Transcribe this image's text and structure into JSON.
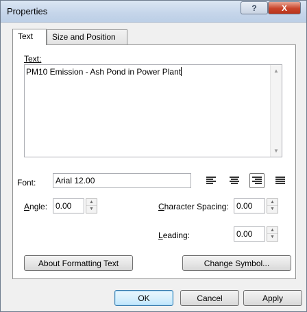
{
  "window": {
    "title": "Properties",
    "help_glyph": "?",
    "close_glyph": "X"
  },
  "tabs": [
    {
      "label": "Text"
    },
    {
      "label": "Size and Position"
    }
  ],
  "text_section": {
    "label": "Text:",
    "value": "PM10 Emission - Ash Pond in Power Plant"
  },
  "font": {
    "label": "Font:",
    "value": "Arial 12.00"
  },
  "alignment": {
    "options": [
      "align-left",
      "align-center",
      "align-right",
      "justify"
    ],
    "selected": "align-right"
  },
  "angle": {
    "label": "Angle:",
    "value": "0.00"
  },
  "character_spacing": {
    "label": "Character Spacing:",
    "value": "0.00"
  },
  "leading": {
    "label": "Leading:",
    "value": "0.00"
  },
  "buttons": {
    "about_formatting": "About Formatting Text",
    "change_symbol": "Change Symbol...",
    "ok": "OK",
    "cancel": "Cancel",
    "apply": "Apply"
  },
  "colors": {
    "title_bar": "#c5d5ea",
    "close_button": "#c9452b",
    "default_button_border": "#3c7fb1"
  }
}
